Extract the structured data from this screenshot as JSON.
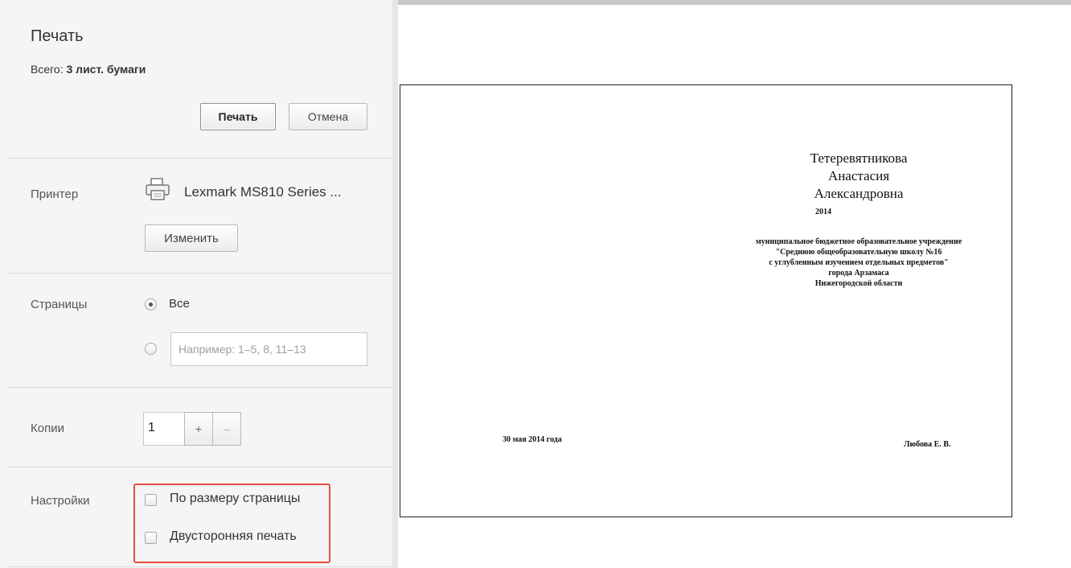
{
  "sidebar": {
    "title": "Печать",
    "total_prefix": "Всего:",
    "total_value": "3 лист. бумаги",
    "print_button": "Печать",
    "cancel_button": "Отмена",
    "printer": {
      "label": "Принтер",
      "name": "Lexmark MS810 Series ...",
      "change_button": "Изменить",
      "icon": "printer-icon"
    },
    "pages": {
      "label": "Страницы",
      "all_option": "Все",
      "selected": "all",
      "range_placeholder": "Например: 1–5, 8, 11–13"
    },
    "copies": {
      "label": "Копии",
      "value": "1",
      "plus": "+",
      "minus": "–"
    },
    "settings": {
      "label": "Настройки",
      "fit_to_page": "По размеру страницы",
      "fit_to_page_checked": false,
      "duplex": "Двусторонняя печать",
      "duplex_checked": false
    },
    "highlight_color": "#e74c3c"
  },
  "preview": {
    "name_line1": "Тетеревятникова",
    "name_line2": "Анастасия",
    "name_line3": "Александровна",
    "year": "2014",
    "org_line1": "муниципальное бюджетное образовательное учреждение",
    "org_line2": "\"Среднюю общеобразовательную школу №16",
    "org_line3": "с углубленным изучением отдельных предметов\"",
    "org_line4": "города Арзамаса",
    "org_line5": "Нижегородской области",
    "date": "30 мая 2014 года",
    "signature": "Любова Е. В."
  }
}
